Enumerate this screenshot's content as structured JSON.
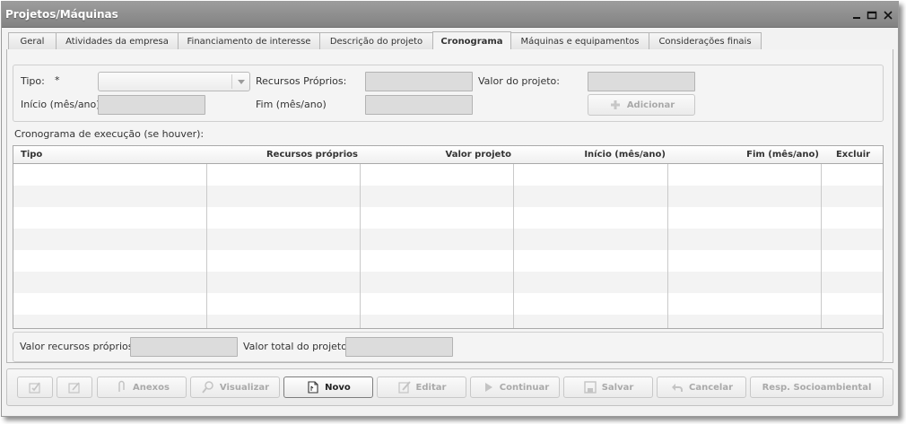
{
  "window": {
    "title": "Projetos/Máquinas"
  },
  "tabs": [
    {
      "label": "Geral"
    },
    {
      "label": "Atividades da empresa"
    },
    {
      "label": "Financiamento de interesse"
    },
    {
      "label": "Descrição do projeto"
    },
    {
      "label": "Cronograma"
    },
    {
      "label": "Máquinas e equipamentos"
    },
    {
      "label": "Considerações finais"
    }
  ],
  "active_tab": "Cronograma",
  "form": {
    "tipo_label": "Tipo:",
    "required_mark": "*",
    "tipo_value": "",
    "recursos_label": "Recursos Próprios:",
    "recursos_value": "",
    "valor_label": "Valor do projeto:",
    "valor_value": "",
    "inicio_label": "Início (mês/ano)",
    "inicio_value": "",
    "fim_label": "Fim (mês/ano)",
    "fim_value": "",
    "add_button": "Adicionar"
  },
  "schedule": {
    "section_label": "Cronograma de execução (se houver):",
    "columns": [
      "Tipo",
      "Recursos próprios",
      "Valor projeto",
      "Início (mês/ano)",
      "Fim (mês/ano)",
      "Excluir"
    ],
    "rows": []
  },
  "totals": {
    "recursos_label": "Valor recursos próprios:",
    "recursos_value": "",
    "total_label": "Valor total do projeto:",
    "total_value": ""
  },
  "toolbar": {
    "anexos": "Anexos",
    "visualizar": "Visualizar",
    "novo": "Novo",
    "editar": "Editar",
    "continuar": "Continuar",
    "salvar": "Salvar",
    "cancelar": "Cancelar",
    "resp": "Resp. Socioambiental"
  },
  "icons": {
    "minimize": "minimize-icon",
    "maximize": "maximize-icon",
    "close": "close-icon"
  }
}
